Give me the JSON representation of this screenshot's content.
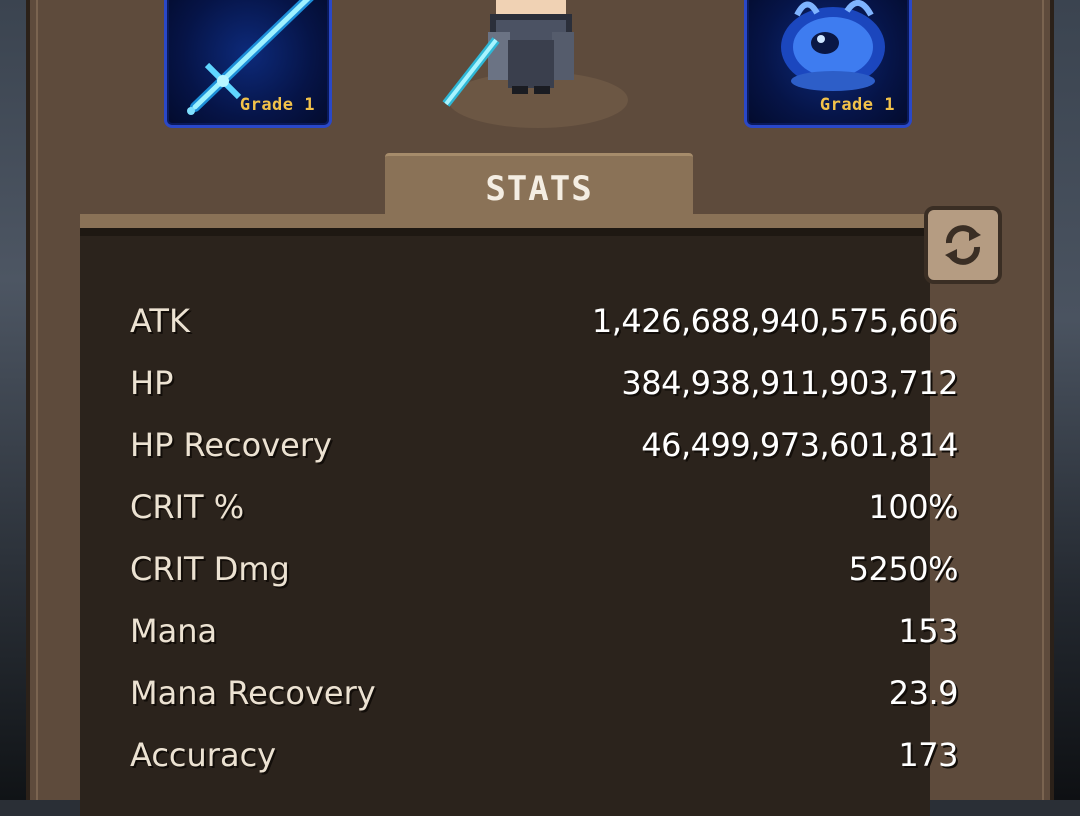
{
  "equipment": {
    "weapon": {
      "grade": "Grade 1",
      "icon": "sword-icon"
    },
    "accessory": {
      "grade": "Grade 1",
      "icon": "blue-orb-icon"
    }
  },
  "tab": {
    "label": "STATS"
  },
  "refresh": {
    "icon": "refresh-icon"
  },
  "stats": [
    {
      "name": "ATK",
      "value": "1,426,688,940,575,606"
    },
    {
      "name": "HP",
      "value": "384,938,911,903,712"
    },
    {
      "name": "HP Recovery",
      "value": "46,499,973,601,814"
    },
    {
      "name": "CRIT %",
      "value": "100%"
    },
    {
      "name": "CRIT Dmg",
      "value": "5250%"
    },
    {
      "name": "Mana",
      "value": "153"
    },
    {
      "name": "Mana Recovery",
      "value": "23.9"
    },
    {
      "name": "Accuracy",
      "value": "173"
    }
  ],
  "colors": {
    "panel": "#5e4b3c",
    "stats_bg": "#2b231c",
    "tab": "#8a7257",
    "grade_text": "#f2c24a",
    "slot_border": "#2a48c8"
  }
}
